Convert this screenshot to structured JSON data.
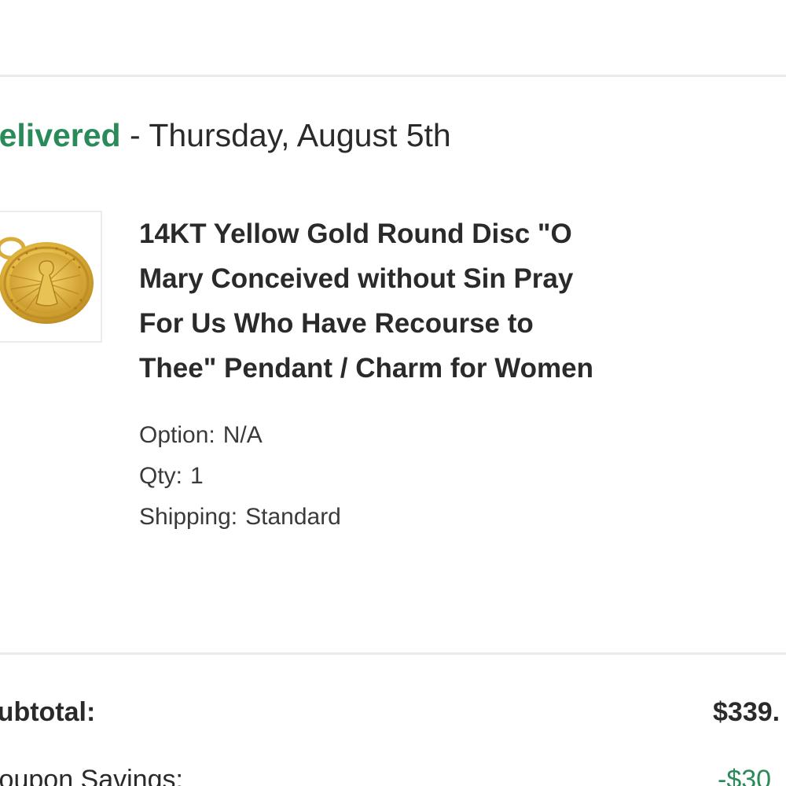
{
  "order": {
    "status": "Delivered",
    "status_separator": " - ",
    "delivery_date": "Thursday, August 5th",
    "status_color": "#2b8a5a"
  },
  "item": {
    "title": "14KT Yellow Gold Round Disc \"O\nMary Conceived without Sin Pray\nFor Us Who Have Recourse to\nThee\" Pendant / Charm for Women",
    "image_icon": "gold-medallion-pendant",
    "option_label": "Option:",
    "option_value": "N/A",
    "qty_label": "Qty:",
    "qty_value": "1",
    "shipping_label": "Shipping:",
    "shipping_value": "Standard"
  },
  "summary": {
    "subtotal_label": "Subtotal:",
    "subtotal_value": "$339.",
    "coupon_label": "Coupon Savings:",
    "coupon_value": "-$30",
    "savings_color": "#2b8a5a"
  }
}
